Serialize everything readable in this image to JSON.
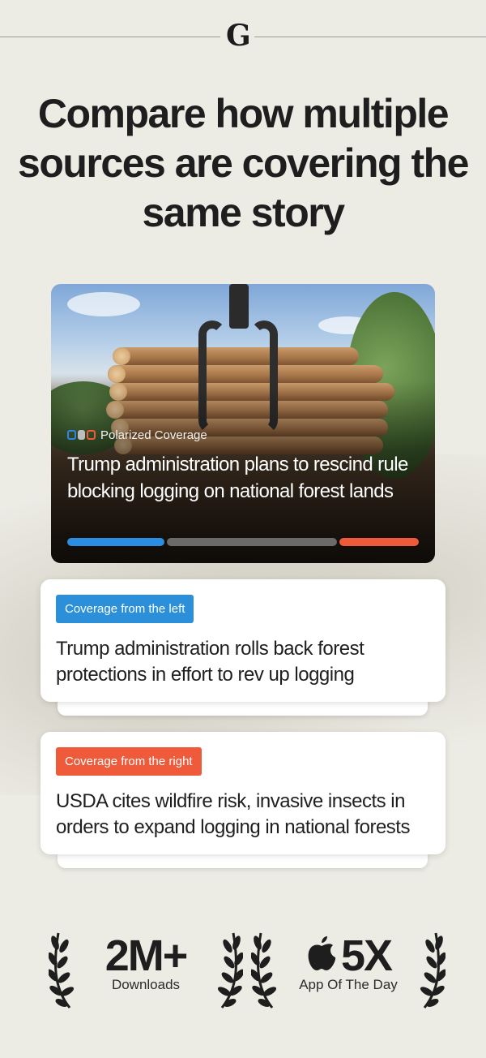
{
  "app": {
    "logo_letter": "G"
  },
  "headline": "Compare how multiple sources are covering the same story",
  "hero": {
    "badge": "Polarized Coverage",
    "title": "Trump administration plans to rescind rule blocking logging on national forest lands",
    "bias": {
      "left": 0.28,
      "center": 0.49,
      "right": 0.23
    },
    "colors": {
      "left": "#2b8ee0",
      "center": "#6a6a6a",
      "right": "#ee5a3a"
    }
  },
  "cards": [
    {
      "tag": "Coverage from the left",
      "title": "Trump administration rolls back forest protections in effort to rev up logging",
      "tag_color": "#2b8fd9"
    },
    {
      "tag": "Coverage from the right",
      "title": "USDA cites wildfire risk, invasive insects in orders to expand logging in national forests",
      "tag_color": "#ee5a3a"
    }
  ],
  "awards": [
    {
      "value": "2M+",
      "caption": "Downloads",
      "icon": "laurel-icon"
    },
    {
      "value": "5X",
      "caption": "App Of The Day",
      "icon": "apple-icon"
    }
  ]
}
